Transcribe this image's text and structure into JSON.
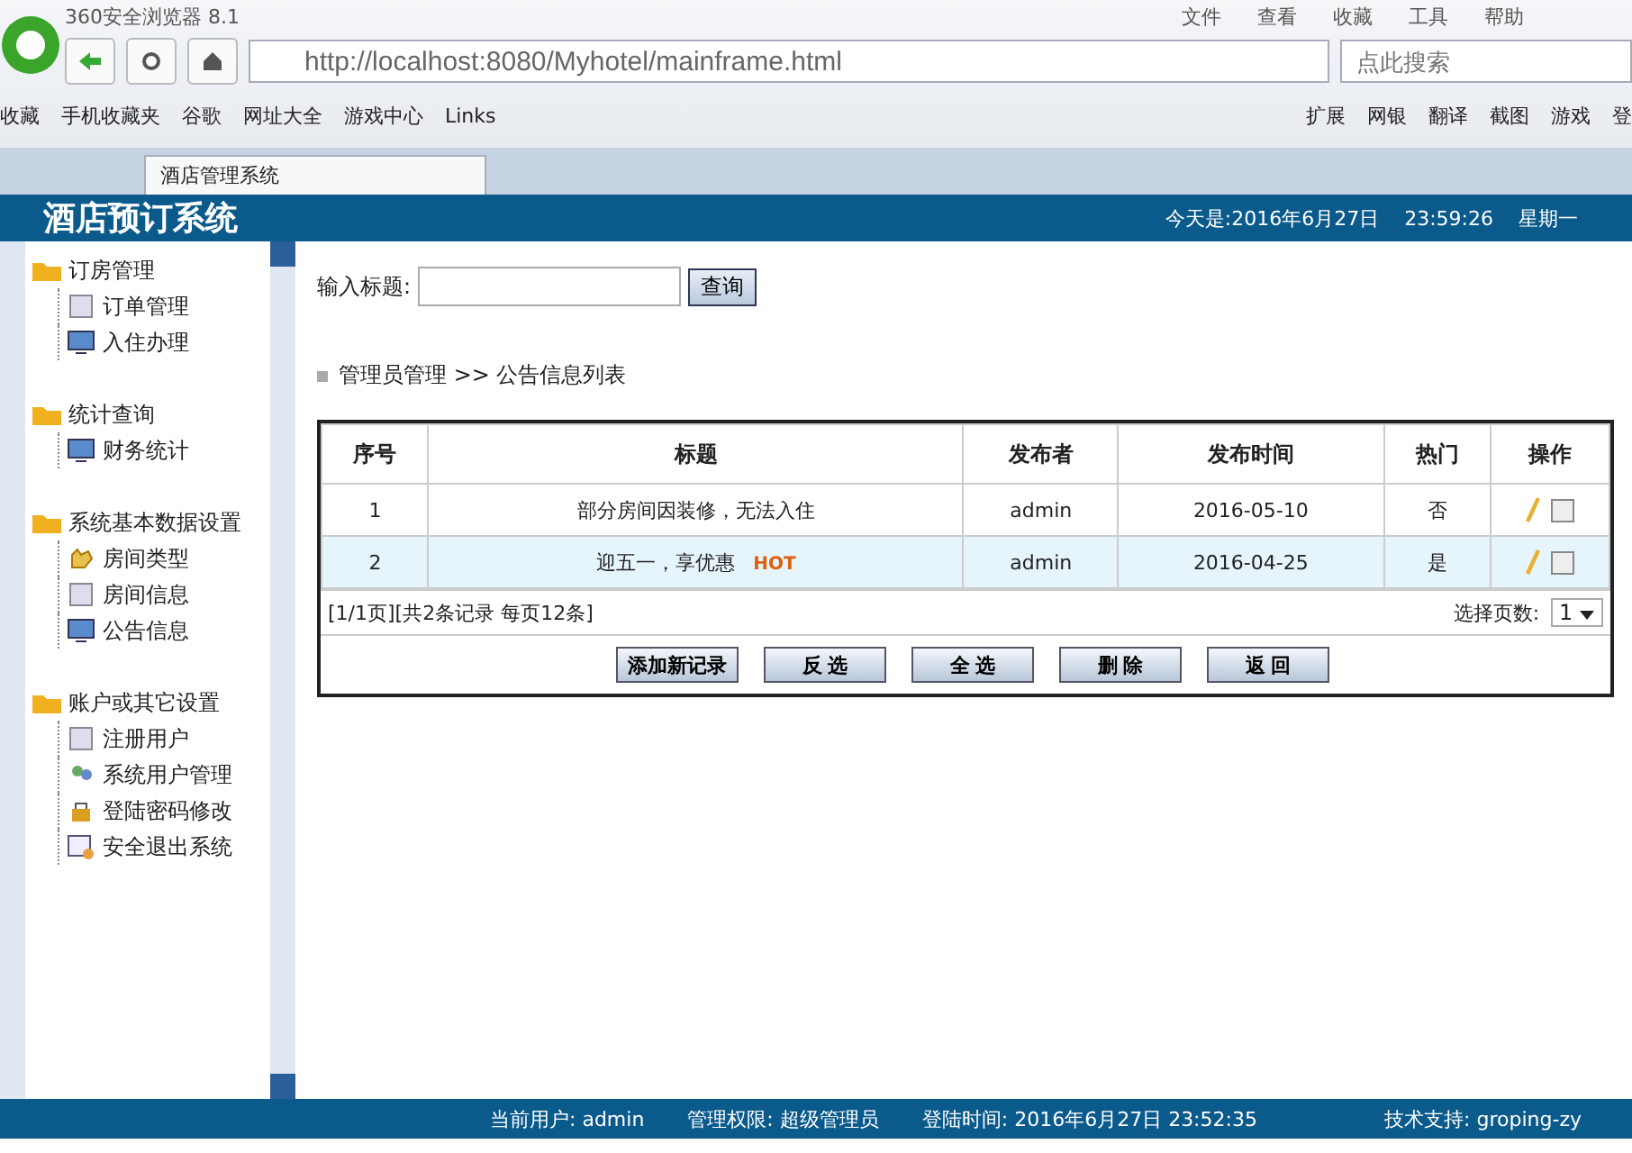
{
  "browser": {
    "title": "360安全浏览器 8.1",
    "menu": [
      "文件",
      "查看",
      "收藏",
      "工具",
      "帮助"
    ],
    "url": "http://localhost:8080/Myhotel/mainframe.html",
    "search_placeholder": "点此搜索",
    "bookmarks": [
      "收藏",
      "手机收藏夹",
      "谷歌",
      "网址大全",
      "游戏中心",
      "Links"
    ],
    "tools": [
      "扩展",
      "网银",
      "翻译",
      "截图",
      "游戏",
      "登"
    ],
    "tabs": [
      {
        "label": "酒店管理系统",
        "selected": true
      }
    ]
  },
  "header": {
    "title": "酒店预订系统",
    "date": "今天是:2016年6月27日",
    "time": "23:59:26",
    "weekday": "星期一"
  },
  "sidebar": {
    "groups": [
      {
        "label": "订房管理",
        "children": [
          {
            "label": "订单管理",
            "kind": "page"
          },
          {
            "label": "入住办理",
            "kind": "monitor"
          }
        ]
      },
      {
        "label": "统计查询",
        "children": [
          {
            "label": "财务统计",
            "kind": "monitor"
          }
        ]
      },
      {
        "label": "系统基本数据设置",
        "children": [
          {
            "label": "房间类型",
            "kind": "hand"
          },
          {
            "label": "房间信息",
            "kind": "page"
          },
          {
            "label": "公告信息",
            "kind": "monitor"
          }
        ]
      },
      {
        "label": "账户或其它设置",
        "children": [
          {
            "label": "注册用户",
            "kind": "page"
          },
          {
            "label": "系统用户管理",
            "kind": "users"
          },
          {
            "label": "登陆密码修改",
            "kind": "lock"
          },
          {
            "label": "安全退出系统",
            "kind": "exit"
          }
        ]
      }
    ]
  },
  "search": {
    "label": "输入标题:",
    "button": "查询"
  },
  "breadcrumb": "管理员管理 >> 公告信息列表",
  "table": {
    "columns": [
      "序号",
      "标题",
      "发布者",
      "发布时间",
      "热门",
      "操作"
    ],
    "rows": [
      {
        "cells": [
          "1",
          "部分房间因装修，无法入住",
          "admin",
          "2016-05-10",
          "否"
        ],
        "hot_badge": null,
        "selected": false,
        "checked": false
      },
      {
        "cells": [
          "2",
          "迎五一，享优惠",
          "admin",
          "2016-04-25",
          "是"
        ],
        "hot_badge": "HOT",
        "selected": true,
        "checked": false
      }
    ],
    "pager": "[1/1页][共2条记录 每页12条]",
    "page_label": "选择页数:",
    "page_value": "1",
    "buttons": [
      "添加新记录",
      "反 选",
      "全 选",
      "删 除",
      "返 回"
    ]
  },
  "status_bar": {
    "user": "当前用户: admin",
    "role": "管理权限: 超级管理员",
    "login": "登陆时间: 2016年6月27日 23:52:35",
    "support": "技术支持: groping-zy"
  }
}
